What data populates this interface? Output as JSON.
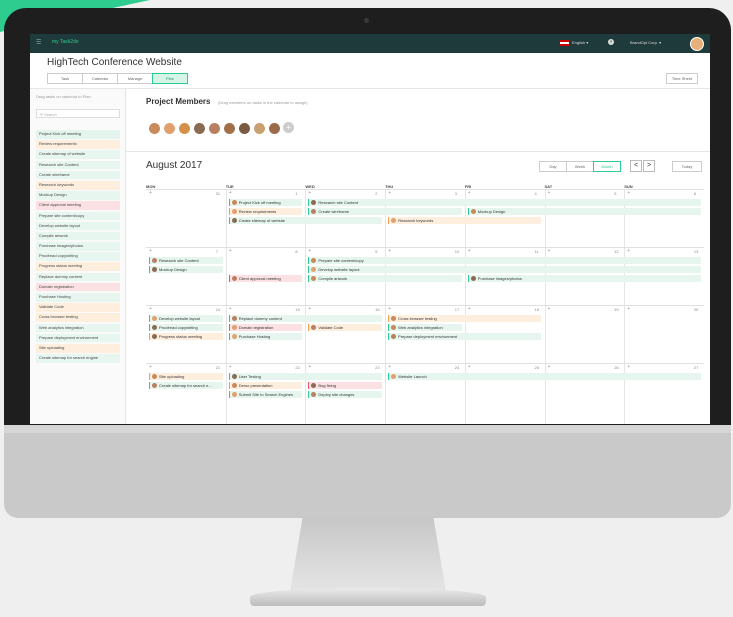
{
  "app": {
    "logo": "my Task2do",
    "language": "English",
    "company": "BrandOpt Corp."
  },
  "project": {
    "title": "HighTech Conference Website"
  },
  "tabs": [
    "Task",
    "Calendar",
    "Manage",
    "Plan"
  ],
  "active_tab": "Plan",
  "time_sheet": "Time Sheet",
  "sidebar": {
    "hint": "Drag tasks on calendar to Plan",
    "search_placeholder": "Search",
    "items": [
      {
        "label": "Project Kick off meeting",
        "color": "green"
      },
      {
        "label": "Review requirements",
        "color": "orange"
      },
      {
        "label": "Create sitemap of website",
        "color": "mint"
      },
      {
        "label": "Research site Content",
        "color": "mint"
      },
      {
        "label": "Create wireframe",
        "color": "mint"
      },
      {
        "label": "Research keywords",
        "color": "orange"
      },
      {
        "label": "Mockup Design",
        "color": "mint"
      },
      {
        "label": "Client approval meeting",
        "color": "red"
      },
      {
        "label": "Prepare site content/copy",
        "color": "mint"
      },
      {
        "label": "Develop website layout",
        "color": "mint"
      },
      {
        "label": "Compile artwork",
        "color": "mint"
      },
      {
        "label": "Purchase images/photos",
        "color": "mint"
      },
      {
        "label": "Proofread copywriting",
        "color": "mint"
      },
      {
        "label": "Progress status meeting",
        "color": "orange"
      },
      {
        "label": "Replace dummy content",
        "color": "mint"
      },
      {
        "label": "Domain registration",
        "color": "red"
      },
      {
        "label": "Purchase Hosting",
        "color": "mint"
      },
      {
        "label": "Validate Code",
        "color": "orange"
      },
      {
        "label": "Cross browser testing",
        "color": "orange"
      },
      {
        "label": "Web analytics integration",
        "color": "mint"
      },
      {
        "label": "Prepare deployment environment",
        "color": "mint"
      },
      {
        "label": "Site uploading",
        "color": "orange"
      },
      {
        "label": "Create sitemap for search engine",
        "color": "mint"
      }
    ]
  },
  "members": {
    "title": "Project Members",
    "hint": "(Drag members on tasks in the calendar to assign)",
    "count": 9
  },
  "calendar": {
    "month": "August 2017",
    "views": [
      "Day",
      "Week",
      "Month"
    ],
    "active_view": "Month",
    "prev": "<",
    "next": ">",
    "today": "Today",
    "days_of_week": [
      "MON",
      "TUE",
      "WED",
      "THU",
      "FRI",
      "SAT",
      "SUN"
    ],
    "weeks": [
      {
        "days": [
          "31",
          "1",
          "2",
          "3",
          "4",
          "5",
          "6"
        ]
      },
      {
        "days": [
          "7",
          "8",
          "9",
          "10",
          "11",
          "12",
          "13"
        ]
      },
      {
        "days": [
          "14",
          "15",
          "16",
          "17",
          "18",
          "19",
          "20"
        ]
      },
      {
        "days": [
          "21",
          "22",
          "23",
          "24",
          "25",
          "26",
          "27"
        ]
      }
    ],
    "events": [
      {
        "label": "Project Kick off meeting",
        "week": 0,
        "col": 1,
        "span": 1,
        "row": 0,
        "color": "green"
      },
      {
        "label": "Research site Content",
        "week": 0,
        "col": 2,
        "span": 5,
        "row": 0,
        "color": "green"
      },
      {
        "label": "Review requirements",
        "week": 0,
        "col": 1,
        "span": 1,
        "row": 1,
        "color": "orange"
      },
      {
        "label": "Create wireframe",
        "week": 0,
        "col": 2,
        "span": 2,
        "row": 1,
        "color": "green"
      },
      {
        "label": "Mockup Design",
        "week": 0,
        "col": 4,
        "span": 3,
        "row": 1,
        "color": "green"
      },
      {
        "label": "Create sitemap of website",
        "week": 0,
        "col": 1,
        "span": 2,
        "row": 2,
        "color": "green"
      },
      {
        "label": "Research keywords",
        "week": 0,
        "col": 3,
        "span": 2,
        "row": 2,
        "color": "orange"
      },
      {
        "label": "Research site Content",
        "week": 1,
        "col": 0,
        "span": 1,
        "row": 0,
        "color": "green"
      },
      {
        "label": "Prepare site content/copy",
        "week": 1,
        "col": 2,
        "span": 5,
        "row": 0,
        "color": "green"
      },
      {
        "label": "Mockup Design",
        "week": 1,
        "col": 0,
        "span": 1,
        "row": 1,
        "color": "green"
      },
      {
        "label": "Develop website layout",
        "week": 1,
        "col": 2,
        "span": 5,
        "row": 1,
        "color": "green"
      },
      {
        "label": "Client approval meeting",
        "week": 1,
        "col": 1,
        "span": 1,
        "row": 2,
        "color": "red"
      },
      {
        "label": "Compile artwork",
        "week": 1,
        "col": 2,
        "span": 2,
        "row": 2,
        "color": "green"
      },
      {
        "label": "Purchase images/photos",
        "week": 1,
        "col": 4,
        "span": 3,
        "row": 2,
        "color": "green"
      },
      {
        "label": "Develop website layout",
        "week": 2,
        "col": 0,
        "span": 1,
        "row": 0,
        "color": "green"
      },
      {
        "label": "Replace dummy content",
        "week": 2,
        "col": 1,
        "span": 2,
        "row": 0,
        "color": "green"
      },
      {
        "label": "Cross browser testing",
        "week": 2,
        "col": 3,
        "span": 2,
        "row": 0,
        "color": "orange"
      },
      {
        "label": "Proofread copywriting",
        "week": 2,
        "col": 0,
        "span": 1,
        "row": 1,
        "color": "green"
      },
      {
        "label": "Domain registration",
        "week": 2,
        "col": 1,
        "span": 1,
        "row": 1,
        "color": "red"
      },
      {
        "label": "Validate Code",
        "week": 2,
        "col": 2,
        "span": 1,
        "row": 1,
        "color": "orange"
      },
      {
        "label": "Web analytics integration",
        "week": 2,
        "col": 3,
        "span": 1,
        "row": 1,
        "color": "green"
      },
      {
        "label": "Progress status meeting",
        "week": 2,
        "col": 0,
        "span": 1,
        "row": 2,
        "color": "orange"
      },
      {
        "label": "Purchase Hosting",
        "week": 2,
        "col": 1,
        "span": 1,
        "row": 2,
        "color": "green"
      },
      {
        "label": "Prepare deployment environment",
        "week": 2,
        "col": 3,
        "span": 2,
        "row": 2,
        "color": "green"
      },
      {
        "label": "Site uploading",
        "week": 3,
        "col": 0,
        "span": 1,
        "row": 0,
        "color": "orange"
      },
      {
        "label": "User Testing",
        "week": 3,
        "col": 1,
        "span": 2,
        "row": 0,
        "color": "green"
      },
      {
        "label": "Website Launch",
        "week": 3,
        "col": 3,
        "span": 4,
        "row": 0,
        "color": "green"
      },
      {
        "label": "Create sitemap for search e...",
        "week": 3,
        "col": 0,
        "span": 1,
        "row": 1,
        "color": "green"
      },
      {
        "label": "Demo presentation",
        "week": 3,
        "col": 1,
        "span": 1,
        "row": 1,
        "color": "orange"
      },
      {
        "label": "Bug fixing",
        "week": 3,
        "col": 2,
        "span": 1,
        "row": 1,
        "color": "red"
      },
      {
        "label": "Submit Site to Search Engines",
        "week": 3,
        "col": 1,
        "span": 1,
        "row": 2,
        "color": "green"
      },
      {
        "label": "Deploy site changes",
        "week": 3,
        "col": 2,
        "span": 1,
        "row": 2,
        "color": "green"
      }
    ]
  },
  "colors": {
    "accent": "#2ecc8f",
    "topbar": "#1f3a3a",
    "orange": "#f0a050",
    "red": "#e05a6a"
  }
}
